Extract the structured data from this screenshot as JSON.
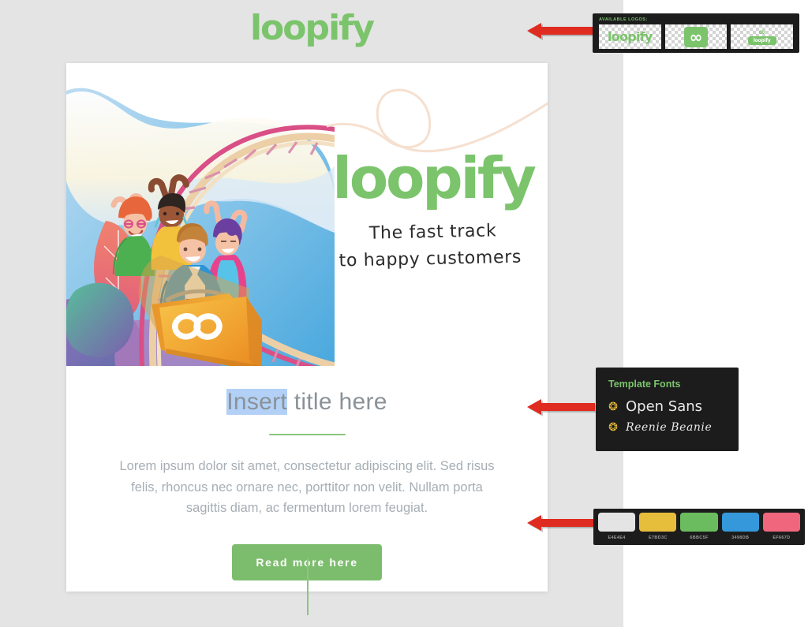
{
  "brand": {
    "name": "loopify",
    "logo_color": "#7BC46C",
    "infinity_glyph": "∞"
  },
  "email_template": {
    "hero": {
      "logo_text": "loopify",
      "tagline_line1": "The fast track",
      "tagline_line2": "to happy customers",
      "illustration_alt": "four people riding a roller coaster cart marked with an infinity symbol",
      "cart_mark": "∞"
    },
    "title": {
      "selected_text": "Insert",
      "rest_text": " title here",
      "full_text": "Insert title here"
    },
    "body_text": "Lorem ipsum dolor sit amet, consectetur adipiscing elit. Sed risus felis, rhoncus nec ornare nec, porttitor non velit. Nullam porta sagittis diam, ac fermentum lorem feugiat.",
    "cta_label": "Read more here"
  },
  "panels": {
    "logos": {
      "title": "AVAILABLE LOGOS:",
      "items": [
        {
          "name": "wordmark-logo",
          "label": "loopify"
        },
        {
          "name": "infinity-mark-logo",
          "label": "∞"
        },
        {
          "name": "stacked-logo",
          "label": "loopify",
          "mark": "∞"
        }
      ]
    },
    "fonts": {
      "title": "Template Fonts",
      "bullet_color": "#F2C53D",
      "items": [
        {
          "name": "Open Sans",
          "style": "sans"
        },
        {
          "name": "Reenie Beanie",
          "style": "handwriting"
        }
      ]
    },
    "colors": {
      "swatches": [
        {
          "hex": "E4E4E4",
          "value": "#E4E4E4"
        },
        {
          "hex": "E7BD3C",
          "value": "#E7BD3C"
        },
        {
          "hex": "6BBC5F",
          "value": "#6BBC5F"
        },
        {
          "hex": "3498DB",
          "value": "#3498DB"
        },
        {
          "hex": "EF667D",
          "value": "#EF667D"
        }
      ]
    }
  },
  "annotations": {
    "arrow_color": "#E02B20",
    "arrows": [
      {
        "name": "arrow-to-logos",
        "points_to": "logos"
      },
      {
        "name": "arrow-to-fonts",
        "points_to": "fonts"
      },
      {
        "name": "arrow-to-colors",
        "points_to": "colors"
      }
    ]
  }
}
